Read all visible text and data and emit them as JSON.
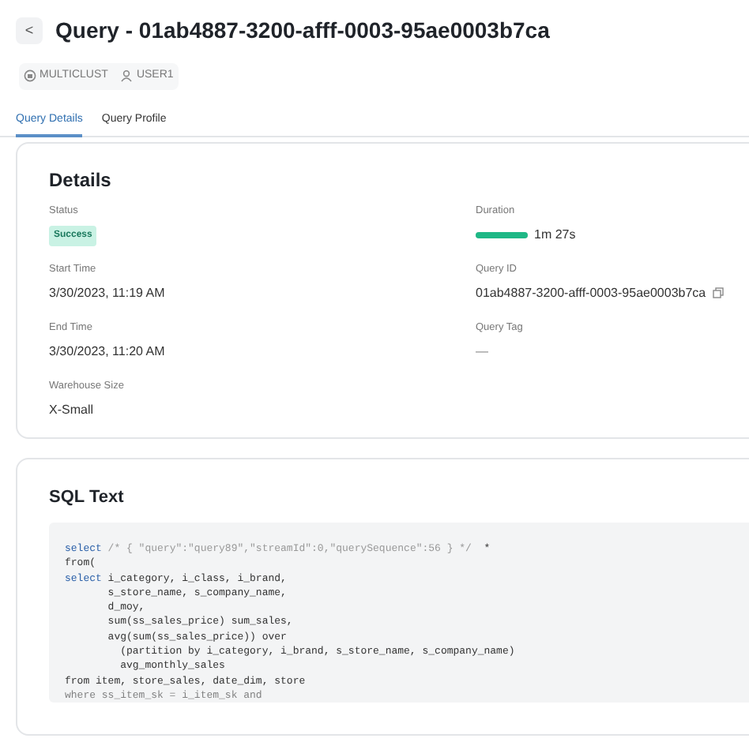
{
  "header": {
    "back": "<",
    "title": "Query - 01ab4887-3200-afff-0003-95ae0003b7ca"
  },
  "tags": [
    {
      "kind": "warehouse",
      "label": "MULTICLUST"
    },
    {
      "kind": "user",
      "label": "USER1"
    }
  ],
  "tabs": [
    {
      "label": "Query Details",
      "selected": true
    },
    {
      "label": "Query Profile",
      "selected": false
    }
  ],
  "details": {
    "title": "Details",
    "fields": [
      {
        "label": "Status",
        "kind": "badge",
        "value": "Success"
      },
      {
        "label": "Duration",
        "kind": "bar",
        "value": "1m 27s",
        "level": 1
      },
      {
        "label": "Start Time",
        "kind": "text",
        "value": "3/30/2023, 11:19 AM"
      },
      {
        "label": "Query ID",
        "kind": "copy",
        "value": "01ab4887-3200-afff-0003-95ae0003b7ca"
      },
      {
        "label": "End Time",
        "kind": "text",
        "value": "3/30/2023, 11:20 AM"
      },
      {
        "label": "Query Tag",
        "kind": "muted",
        "value": "—"
      },
      {
        "label": "Warehouse Size",
        "kind": "text",
        "value": "X-Small"
      }
    ]
  },
  "sql": {
    "title": "SQL Text",
    "lines": [
      {
        "faded": false,
        "parts": [
          {
            "kind": "keyword",
            "text": "select"
          },
          {
            "kind": "comment",
            "text": " /* { \"query\":\"query89\",\"streamId\":0,\"querySequence\":56 } */"
          },
          {
            "kind": "code",
            "text": "  *"
          }
        ]
      },
      {
        "faded": false,
        "parts": [
          {
            "kind": "code",
            "text": "from("
          }
        ]
      },
      {
        "faded": false,
        "parts": [
          {
            "kind": "keyword",
            "text": "select"
          },
          {
            "kind": "code",
            "text": " i_category, i_class, i_brand,"
          }
        ]
      },
      {
        "faded": false,
        "parts": [
          {
            "kind": "code",
            "text": "       s_store_name, s_company_name,"
          }
        ]
      },
      {
        "faded": false,
        "parts": [
          {
            "kind": "code",
            "text": "       d_moy,"
          }
        ]
      },
      {
        "faded": false,
        "parts": [
          {
            "kind": "code",
            "text": "       sum(ss_sales_price) sum_sales,"
          }
        ]
      },
      {
        "faded": false,
        "parts": [
          {
            "kind": "code",
            "text": "       avg(sum(ss_sales_price)) over"
          }
        ]
      },
      {
        "faded": false,
        "parts": [
          {
            "kind": "code",
            "text": "         (partition by i_category, i_brand, s_store_name, s_company_name)"
          }
        ]
      },
      {
        "faded": false,
        "parts": [
          {
            "kind": "code",
            "text": "         avg_monthly_sales"
          }
        ]
      },
      {
        "faded": false,
        "parts": [
          {
            "kind": "code",
            "text": "from item, store_sales, date_dim, store"
          }
        ]
      },
      {
        "faded": true,
        "parts": [
          {
            "kind": "code",
            "text": "where ss_item_sk = i_item_sk and"
          }
        ]
      }
    ]
  }
}
